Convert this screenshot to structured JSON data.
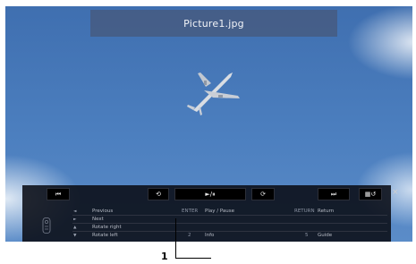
{
  "viewer": {
    "filename": "Picture1.jpg"
  },
  "controller": {
    "buttons": {
      "previous": "⏮",
      "rotate_left": "⟲",
      "play_pause": "►/⏸",
      "rotate_right": "⟳",
      "next": "⏭",
      "grid": "▦↺"
    },
    "close": "×",
    "help": {
      "col1": [
        {
          "key": "◄",
          "label": "Previous"
        },
        {
          "key": "►",
          "label": "Next"
        },
        {
          "key": "▲",
          "label": "Rotate right"
        },
        {
          "key": "▼",
          "label": "Rotate left"
        }
      ],
      "enter_key": "ENTER",
      "enter_label": "Play / Pause",
      "num_key": "2",
      "num_label": "Info",
      "return_key": "RETURN",
      "return_label": "Return",
      "num5_key": "5",
      "num5_label": "Guide"
    }
  },
  "callout": {
    "label": "1"
  },
  "colors": {
    "sky": "#4c7fbf",
    "title_bar": "#46587a",
    "controller_bg": "#0a0c14"
  },
  "icons": {
    "remote": "remote-control-icon",
    "plane": "airplane-image"
  }
}
